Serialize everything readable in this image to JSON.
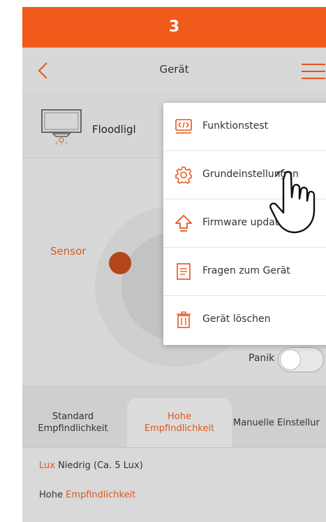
{
  "step": {
    "number": "3"
  },
  "header": {
    "title": "Gerät"
  },
  "device": {
    "name": "Floodligl"
  },
  "sensor": {
    "label": "Sensor"
  },
  "panik": {
    "label": "Panik"
  },
  "tabs": [
    {
      "line1": "Standard",
      "line2": "Empfindlichkeit"
    },
    {
      "line1": "Hohe",
      "line2": "Empfindlichkeit"
    },
    {
      "line1": "Manuelle Einstellur",
      "line2": ""
    }
  ],
  "info": {
    "lux_prefix": "Lux",
    "lux_value": " Niedrig (Ca. 5 Lux)",
    "sens_prefix": "Hohe ",
    "sens_value": "Empfindlichkeit"
  },
  "menu": {
    "items": [
      {
        "label": "Funktionstest",
        "icon": "code-icon"
      },
      {
        "label": "Grundeinstellungen",
        "icon": "gear-icon"
      },
      {
        "label": "Firmware update",
        "icon": "arrow-up-icon"
      },
      {
        "label": "Fragen zum Gerät",
        "icon": "document-icon"
      },
      {
        "label": "Gerät löschen",
        "icon": "trash-icon"
      }
    ]
  },
  "colors": {
    "accent": "#f05a1a",
    "accent_text": "#d95a1e",
    "overlay_gray": "#d8d8d8"
  }
}
